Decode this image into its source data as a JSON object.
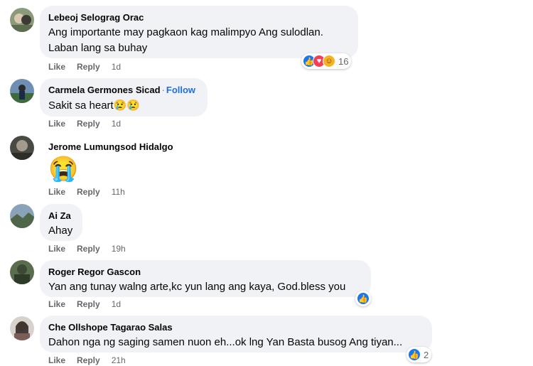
{
  "actions": {
    "like": "Like",
    "reply": "Reply"
  },
  "colors": {
    "bubble": "#f0f2f5",
    "link": "#216fdb",
    "meta": "#65676b",
    "like": "#1877f2"
  },
  "comments": [
    {
      "name": "Lebeoj Selograg Orac",
      "lines": [
        "Ang importante may pagkaon kag malimpyo Ang sulodlan.",
        "Laban lang sa buhay"
      ],
      "time": "1d",
      "reactions": {
        "icons": [
          "like-icon",
          "love-icon",
          "haha-icon"
        ],
        "count": "16"
      }
    },
    {
      "name": "Carmela Germones Sicad",
      "follow": "Follow",
      "separator": "·",
      "lines": [
        "Sakit sa heart"
      ],
      "emojis": "😢😢",
      "time": "1d"
    },
    {
      "name": "Jerome Lumungsod Hidalgo",
      "emoji_only": "😭",
      "time": "11h"
    },
    {
      "name": "Ai Za",
      "lines": [
        "Ahay"
      ],
      "time": "19h"
    },
    {
      "name": "Roger Regor Gascon",
      "lines": [
        "Yan ang tunay walng arte,kc yun lang ang kaya, God.bless you"
      ],
      "time": "1d",
      "reactions": {
        "icons": [
          "like-icon"
        ],
        "count": ""
      }
    },
    {
      "name": "Che Ollshope Tagarao Salas",
      "lines": [
        "Dahon nga ng saging samen nuon eh...ok lng Yan Basta busog Ang tiyan..."
      ],
      "time": "21h",
      "reactions": {
        "icons": [
          "like-icon"
        ],
        "count": "2"
      }
    }
  ]
}
